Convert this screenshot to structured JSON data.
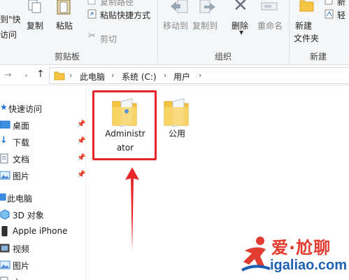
{
  "ribbon": {
    "clipboard": {
      "pin_label_line1": "到\"快",
      "pin_label_line2": "访问",
      "copy_label": "复制",
      "paste_label": "粘贴",
      "copy_path_label": "复制路径",
      "paste_shortcut_label": "粘贴快捷方式",
      "cut_label": "剪切",
      "group_label": "剪贴板"
    },
    "organize": {
      "move_to_label": "移动到",
      "copy_to_label": "复制到",
      "delete_label": "删除",
      "rename_label": "重命名",
      "group_label": "组织"
    },
    "new": {
      "new_folder_line1": "新建",
      "new_folder_line2": "文件夹",
      "new_item_label": "新",
      "easy_access_label": "轻",
      "group_label": "新建"
    }
  },
  "address": {
    "crumbs": [
      "此电脑",
      "系统 (C:)",
      "用户"
    ]
  },
  "nav_pane": {
    "items": [
      {
        "label": "快速访问"
      },
      {
        "label": "桌面"
      },
      {
        "label": "下载"
      },
      {
        "label": "文档"
      },
      {
        "label": "图片"
      },
      {
        "label": "此电脑"
      },
      {
        "label": "3D 对象"
      },
      {
        "label": "Apple iPhone"
      },
      {
        "label": "视频"
      },
      {
        "label": "图片"
      },
      {
        "label": "文"
      }
    ]
  },
  "content": {
    "folders": [
      {
        "name_line1": "Administr",
        "name_line2": "ator"
      },
      {
        "name_line1": "公用"
      }
    ]
  },
  "watermark": {
    "line1": "爱·尬聊",
    "line2": "igaliao.com"
  },
  "colors": {
    "highlight": "#e8262a",
    "folder": "#f5c542",
    "accent_blue": "#1e6fd9"
  }
}
